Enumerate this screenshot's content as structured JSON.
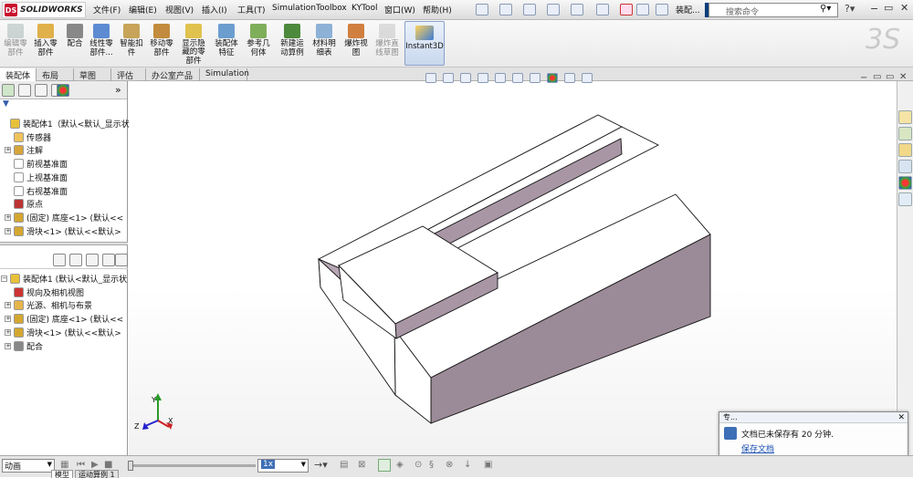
{
  "app": {
    "logo_text": "SOLIDWORKS",
    "logo_mark": "DS",
    "title": "装配..."
  },
  "menu": [
    "文件(F)",
    "编辑(E)",
    "视图(V)",
    "插入(I)",
    "工具(T)",
    "Simulation",
    "Toolbox",
    "KYTool",
    "窗口(W)",
    "帮助(H)"
  ],
  "search": {
    "placeholder": "搜索命令"
  },
  "ribbon": [
    {
      "label": "编辑零\n部件",
      "icon": "edit-component-icon",
      "disabled": true
    },
    {
      "label": "插入零\n部件",
      "icon": "insert-component-icon",
      "disabled": false
    },
    {
      "label": "配合",
      "icon": "mate-icon",
      "disabled": false
    },
    {
      "label": "线性零\n部件...",
      "icon": "linear-pattern-icon",
      "disabled": false
    },
    {
      "label": "智能扣\n件",
      "icon": "smart-fastener-icon",
      "disabled": false
    },
    {
      "label": "移动零\n部件",
      "icon": "move-component-icon",
      "disabled": false
    },
    {
      "label": "显示隐\n藏的零\n部件",
      "icon": "show-hidden-icon",
      "disabled": false
    },
    {
      "label": "装配体\n特征",
      "icon": "assembly-feature-icon",
      "disabled": false
    },
    {
      "label": "参考几\n何体",
      "icon": "reference-geometry-icon",
      "disabled": false
    },
    {
      "label": "新建运\n动算例",
      "icon": "new-motion-study-icon",
      "disabled": false
    },
    {
      "label": "材料明\n细表",
      "icon": "bom-icon",
      "disabled": false
    },
    {
      "label": "爆炸视\n图",
      "icon": "exploded-view-icon",
      "disabled": false
    },
    {
      "label": "爆炸直\n线草图",
      "icon": "explode-line-sketch-icon",
      "disabled": true
    }
  ],
  "instant3d": "Instant3D",
  "tabs": [
    "装配体",
    "布局",
    "草图",
    "评估",
    "办公室产品",
    "Simulation"
  ],
  "active_tab": 0,
  "tree_top": [
    {
      "label": "装配体1（默认<默认_显示状",
      "icon": "assembly-icon",
      "indent": 0,
      "expander": ""
    },
    {
      "label": "传感器",
      "icon": "sensor-icon",
      "indent": 1,
      "expander": ""
    },
    {
      "label": "注解",
      "icon": "annotation-icon",
      "indent": 1,
      "expander": "+"
    },
    {
      "label": "前视基准面",
      "icon": "plane-icon",
      "indent": 1,
      "expander": ""
    },
    {
      "label": "上视基准面",
      "icon": "plane-icon",
      "indent": 1,
      "expander": ""
    },
    {
      "label": "右视基准面",
      "icon": "plane-icon",
      "indent": 1,
      "expander": ""
    },
    {
      "label": "原点",
      "icon": "origin-icon",
      "indent": 1,
      "expander": ""
    },
    {
      "label": "(固定) 底座<1> (默认<<",
      "icon": "part-icon",
      "indent": 1,
      "expander": "+"
    },
    {
      "label": "滑块<1> (默认<<默认>",
      "icon": "part-icon",
      "indent": 1,
      "expander": "+"
    }
  ],
  "tree_bottom": [
    {
      "label": "装配体1 (默认<默认_显示状",
      "icon": "assembly-icon",
      "indent": 0,
      "expander": "−"
    },
    {
      "label": "视向及相机视图",
      "icon": "camera-view-icon",
      "indent": 1,
      "expander": ""
    },
    {
      "label": "光源、相机与布景",
      "icon": "light-icon",
      "indent": 1,
      "expander": "+"
    },
    {
      "label": "(固定) 底座<1> (默认<<",
      "icon": "part-icon",
      "indent": 1,
      "expander": "+"
    },
    {
      "label": "滑块<1> (默认<<默认>",
      "icon": "part-icon",
      "indent": 1,
      "expander": "+"
    },
    {
      "label": "配合",
      "icon": "mates-folder-icon",
      "indent": 1,
      "expander": "+"
    }
  ],
  "status": {
    "mode": "动画",
    "speed": "1x",
    "bottom_tabs": [
      "模型",
      "运动算例 1"
    ]
  },
  "notification": {
    "title": "专...",
    "message": "文档已未保存有 20 分钟.",
    "link": "保存文档"
  },
  "triad": {
    "x": "X",
    "y": "Y",
    "z": "Z"
  },
  "colors": {
    "part_top": "#ffffff",
    "part_side": "#9b8a97",
    "part_front": "#a896a5",
    "edge": "#111111",
    "sw_red": "#c8102e"
  }
}
